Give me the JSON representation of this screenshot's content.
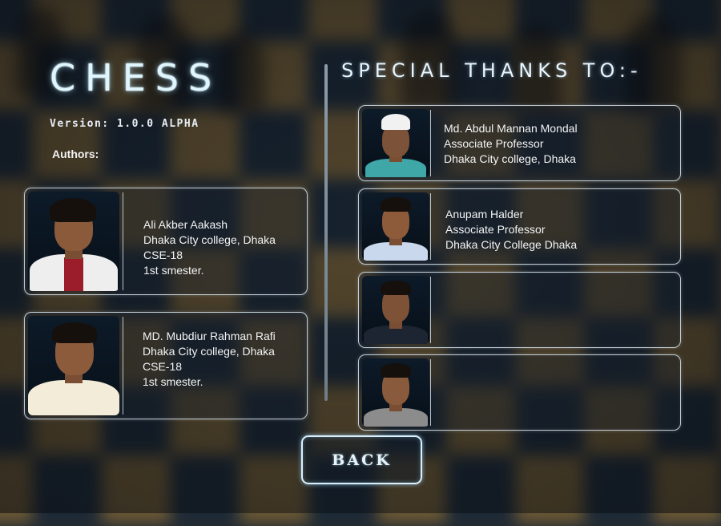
{
  "app": {
    "title": "CHESS",
    "version": "Version: 1.0.0 ALPHA",
    "authors_label": "Authors:"
  },
  "authors": [
    {
      "photo_icon": "portrait-photo",
      "lines": [
        "Ali Akber Aakash",
        "Dhaka City college, Dhaka",
        "CSE-18",
        "1st smester."
      ]
    },
    {
      "photo_icon": "portrait-photo",
      "lines": [
        "MD. Mubdiur Rahman Rafi",
        "Dhaka City college, Dhaka",
        "CSE-18",
        "1st smester."
      ]
    }
  ],
  "thanks": {
    "title": "SPECIAL THANKS TO:-",
    "people": [
      {
        "photo_icon": "portrait-photo",
        "lines": [
          "Md. Abdul Mannan Mondal",
          "Associate Professor",
          "Dhaka City college, Dhaka"
        ]
      },
      {
        "photo_icon": "portrait-photo",
        "lines": [
          "Anupam Halder",
          "Associate Professor",
          "Dhaka City College Dhaka"
        ]
      },
      {
        "photo_icon": "portrait-photo",
        "lines": []
      },
      {
        "photo_icon": "portrait-photo",
        "lines": []
      }
    ]
  },
  "back_button": {
    "label": "BACK"
  },
  "colors": {
    "glow": "#dff6ff",
    "card_border": "#dcebf5",
    "board_light": "#6b5835",
    "board_dark": "#1a2836"
  }
}
